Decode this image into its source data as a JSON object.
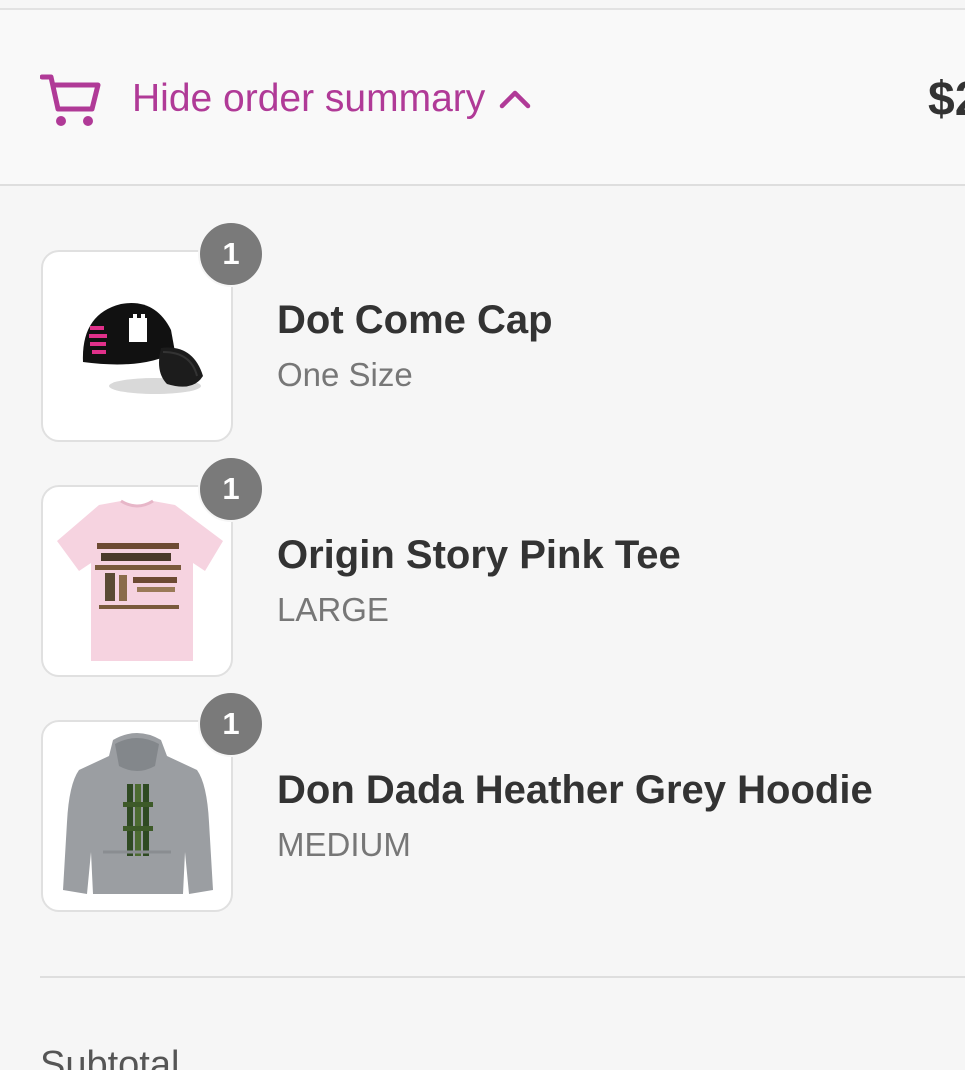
{
  "summary_toggle": {
    "label": "Hide order summary",
    "total": "$2",
    "accent_color": "#b03a97",
    "cart_icon": "shopping-cart-icon",
    "chevron_icon": "chevron-up-icon"
  },
  "line_items": [
    {
      "name": "Dot Come Cap",
      "variant": "One Size",
      "quantity": "1",
      "image": "black-cap-with-pink-text"
    },
    {
      "name": "Origin Story Pink Tee",
      "variant": "LARGE",
      "quantity": "1",
      "image": "pink-tee-with-brown-graphic"
    },
    {
      "name": "Don Dada Heather Grey Hoodie",
      "variant": "MEDIUM",
      "quantity": "1",
      "image": "grey-hoodie-with-green-camo-graphic"
    }
  ],
  "totals": {
    "subtotal_label": "Subtotal"
  }
}
